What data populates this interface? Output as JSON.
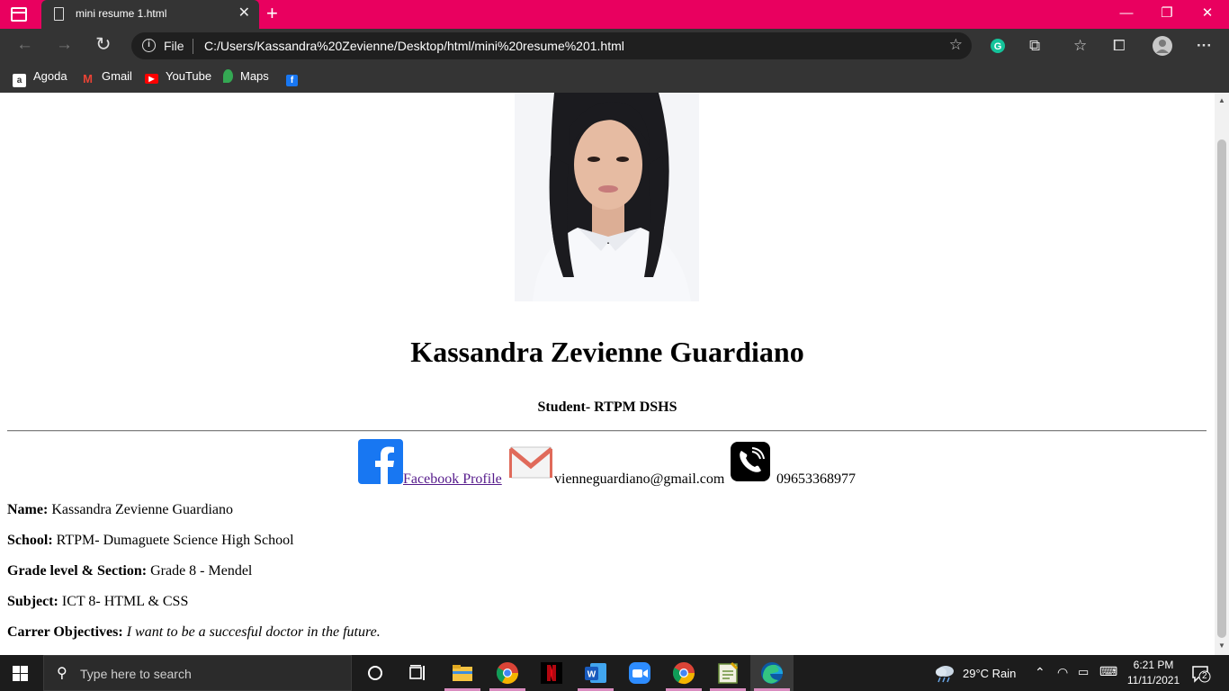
{
  "browser": {
    "tab_title": "mini resume 1.html",
    "tab_close": "✕",
    "new_tab": "+",
    "window_minimize": "—",
    "window_restore": "❐",
    "window_close": "✕",
    "address_scheme": "File",
    "address_url": "C:/Users/Kassandra%20Zevienne/Desktop/html/mini%20resume%201.html",
    "nav_back": "←",
    "nav_forward": "→",
    "nav_refresh": "↻",
    "bookmarks": [
      {
        "label": "Agoda"
      },
      {
        "label": "Gmail"
      },
      {
        "label": "YouTube"
      },
      {
        "label": "Maps"
      },
      {
        "label": ""
      }
    ]
  },
  "resume": {
    "name": "Kassandra Zevienne Guardiano",
    "role": "Student- RTPM DSHS",
    "contacts": {
      "facebook_label": " Facebook Profile ",
      "email": "vienneguardiano@gmail.com",
      "phone": "09653368977"
    },
    "details": [
      {
        "label": "Name:",
        "value": " Kassandra Zevienne Guardiano",
        "italic": false
      },
      {
        "label": "School:",
        "value": " RTPM- Dumaguete Science High School",
        "italic": false
      },
      {
        "label": "Grade level & Section:",
        "value": " Grade 8 - Mendel",
        "italic": false
      },
      {
        "label": "Subject:",
        "value": " ICT 8- HTML & CSS",
        "italic": false
      },
      {
        "label": "Carrer Objectives:",
        "value": " I want to be a succesful doctor in the future.",
        "italic": true
      }
    ]
  },
  "taskbar": {
    "search_placeholder": "Type here to search",
    "weather": "29°C  Rain",
    "time": "6:21 PM",
    "date": "11/11/2021",
    "notification_count": "2"
  },
  "colors": {
    "titlebar": "#e9005f",
    "chrome_dark": "#343434",
    "link_visited": "#551a8b",
    "facebook_blue": "#1877f2"
  }
}
